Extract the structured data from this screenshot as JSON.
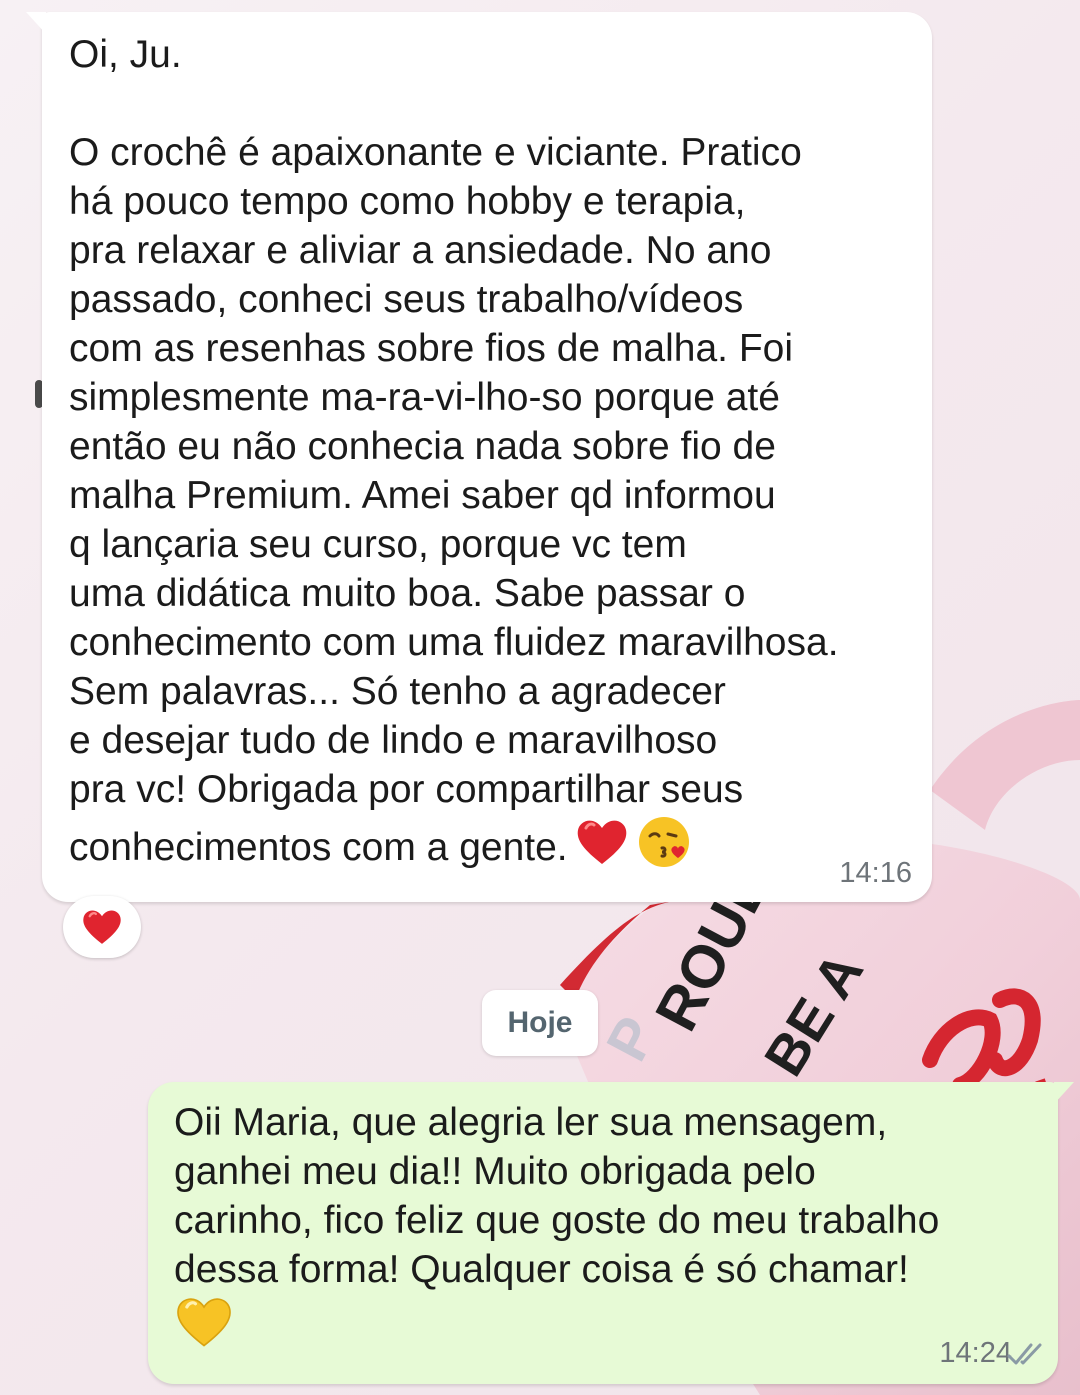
{
  "incoming_message": {
    "text": "Oi, Ju.\n\nO crochê é apaixonante e viciante. Pratico\nhá pouco tempo como hobby e terapia,\npra relaxar e aliviar a ansiedade. No ano\npassado, conheci seus trabalho/vídeos\ncom as resenhas sobre fios de malha. Foi\nsimplesmente ma-ra-vi-lho-so porque até\nentão eu não conhecia nada sobre fio de\nmalha Premium. Amei saber qd informou\nq lançaria seu curso, porque vc tem\numa didática muito boa. Sabe passar o\nconhecimento com uma fluidez maravilhosa.\nSem palavras... Só tenho a agradecer\ne desejar tudo de lindo e maravilhoso\npra vc! Obrigada por compartilhar seus",
    "last_line": "conhecimentos com a gente.",
    "emojis": [
      "heart-emoji",
      "kiss-emoji"
    ],
    "time": "14:16",
    "reaction": "heart-emoji"
  },
  "date_separator": "Hoje",
  "outgoing_message": {
    "text": "Oii Maria, que alegria ler sua mensagem,\nganhei meu dia!! Muito obrigada pelo\ncarinho, fico feliz que goste do meu trabalho\ndessa forma! Qualquer coisa é só chamar!",
    "emoji": "yellow-heart-emoji",
    "time": "14:24",
    "status": "read-double-check-icon"
  },
  "colors": {
    "incoming_bubble": "#ffffff",
    "outgoing_bubble": "#e7fad6",
    "heart_red": "#e0242f",
    "heart_yellow": "#f7c325",
    "timestamp": "#6e7479"
  }
}
